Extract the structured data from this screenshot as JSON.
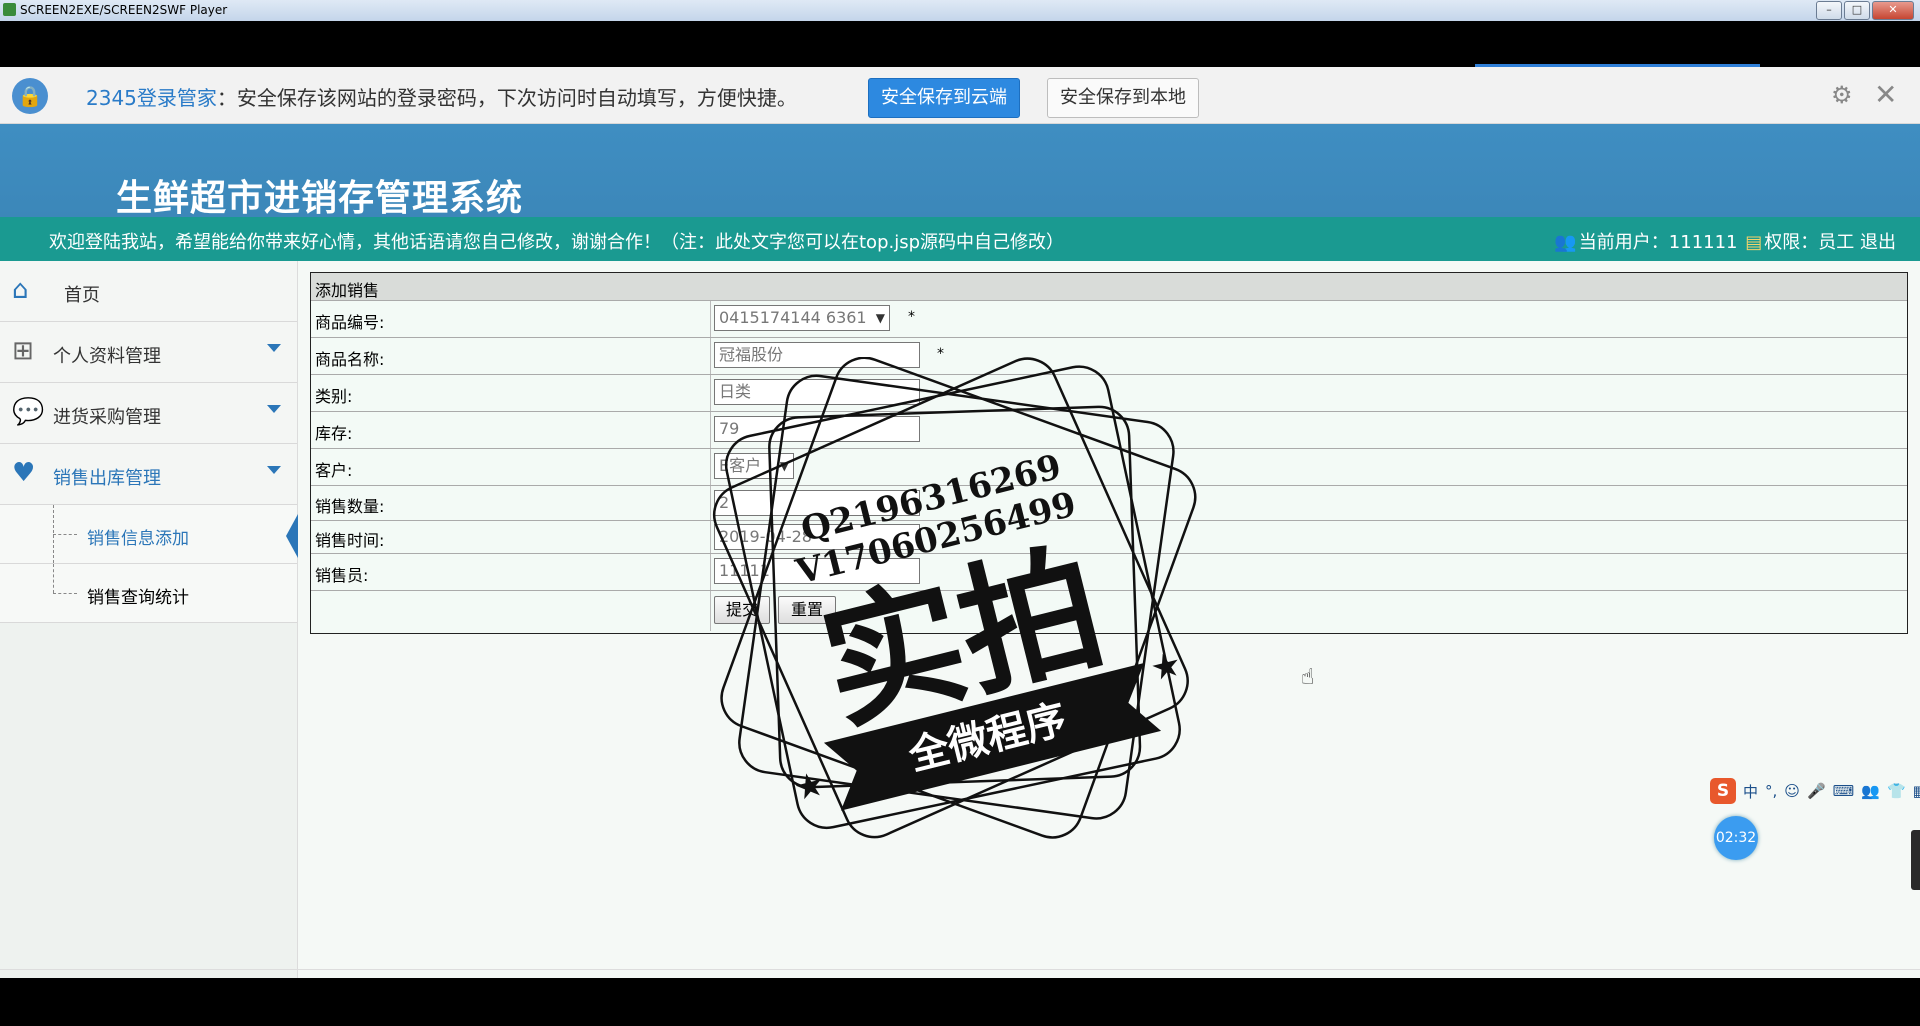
{
  "window": {
    "title": "SCREEN2EXE/SCREEN2SWF Player",
    "min": "–",
    "max": "□",
    "close": "✕"
  },
  "notify": {
    "brand": "2345登录管家",
    "message": "：安全保存该网站的登录密码，下次访问时自动填写，方便快捷。",
    "cloud_button": "安全保存到云端",
    "local_button": "安全保存到本地"
  },
  "header": {
    "title": "生鲜超市进销存管理系统",
    "welcome": "欢迎登陆我站，希望能给你带来好心情，其他话语请您自己修改，谢谢合作！（注：此处文字您可以在top.jsp源码中自己修改）",
    "user_label": "当前用户：",
    "user_value": "111111",
    "role_label": "权限：",
    "role_value": "员工",
    "logout": "退出"
  },
  "sidebar": {
    "home": "首页",
    "personal": "个人资料管理",
    "purchase": "进货采购管理",
    "sales": "销售出库管理",
    "sub_add": "销售信息添加",
    "sub_query": "销售查询统计"
  },
  "form": {
    "title": "添加销售",
    "product_code_label": "商品编号:",
    "product_code_value": "0415174144 6361",
    "product_name_label": "商品名称:",
    "product_name_value": "冠福股份",
    "category_label": "类别:",
    "category_value": "日类",
    "stock_label": "库存:",
    "stock_value": "79",
    "customer_label": "客户:",
    "customer_value": "E客户",
    "quantity_label": "销售数量:",
    "quantity_value": "2",
    "time_label": "销售时间:",
    "time_value": "2019-04-28",
    "seller_label": "销售员:",
    "seller_value": "11111",
    "submit": "提交",
    "reset": "重置",
    "required": "*"
  },
  "watermark": {
    "line1": "Q2196316269",
    "line2": "V17060256499",
    "big": "实拍",
    "banner": "全微程序"
  },
  "ime": {
    "logo": "S",
    "mode": "中",
    "punct": "°,",
    "items": [
      "☺",
      "🎤",
      "⌨",
      "👥",
      "👕",
      "▦"
    ]
  },
  "timer": "02:32",
  "icons": {
    "lock": "lock-icon",
    "gear": "gear-icon",
    "close": "close-icon",
    "home": "home-icon",
    "grid": "grid-icon",
    "chat": "chat-icon",
    "heart": "heart-icon",
    "user": "user-icon",
    "role": "card-icon",
    "hand": "hand-cursor-icon"
  }
}
